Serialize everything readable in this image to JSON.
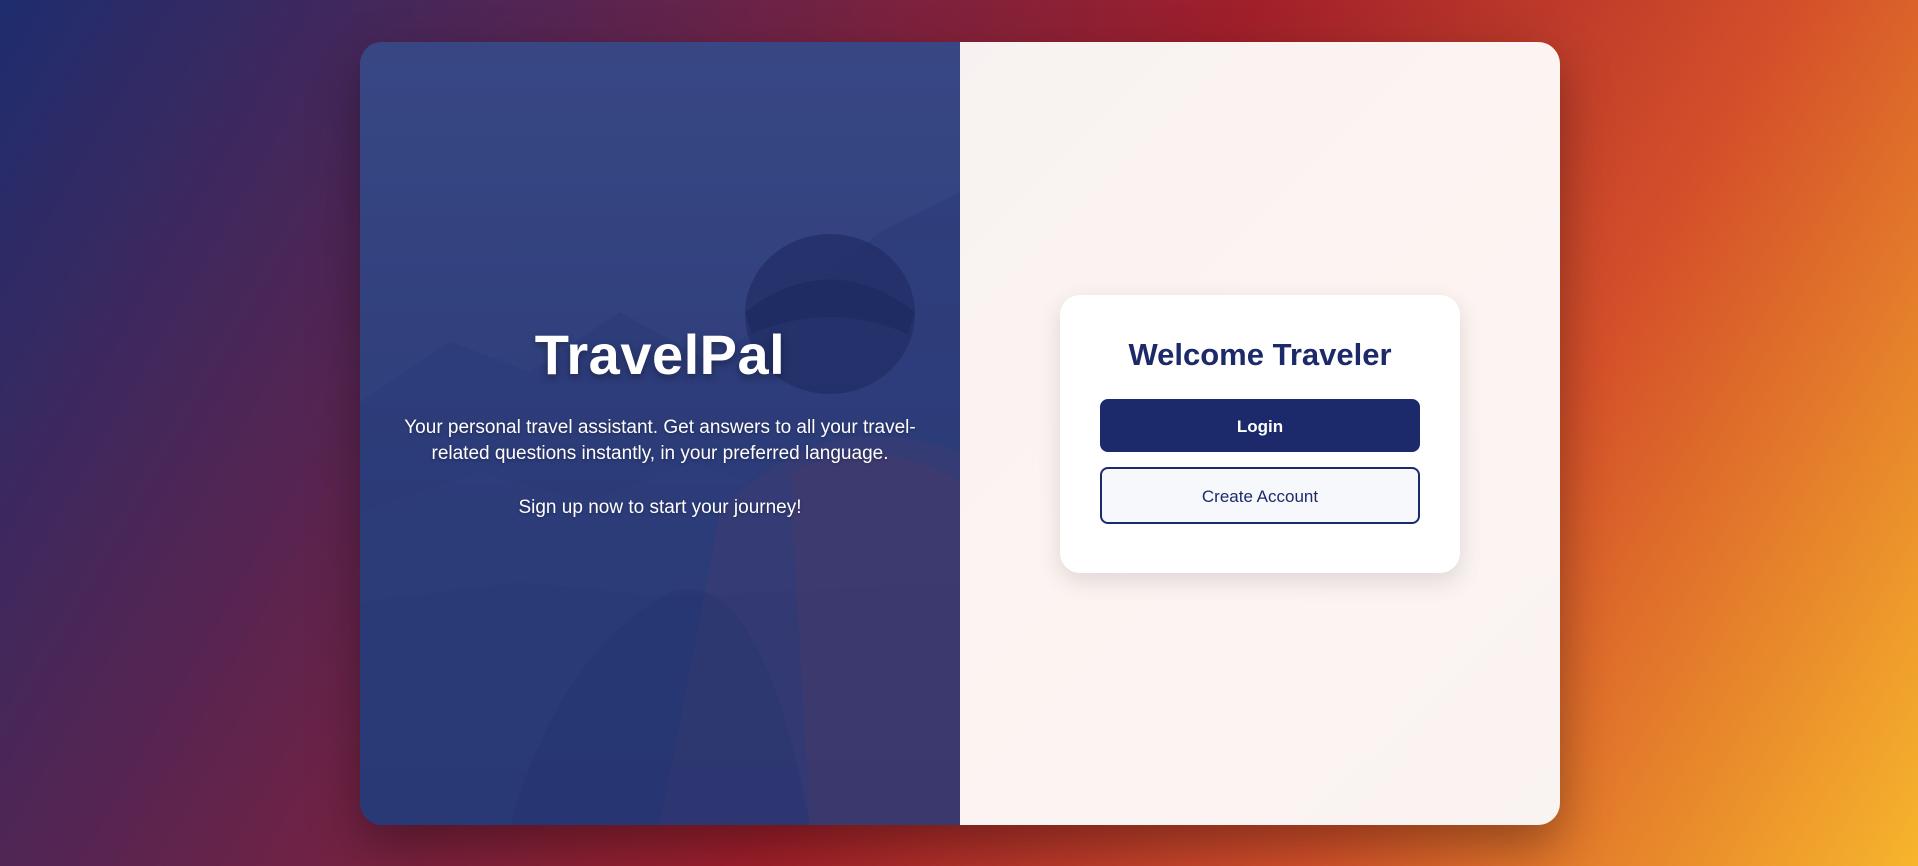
{
  "brand": {
    "title": "TravelPal",
    "description": "Your personal travel assistant. Get answers to all your travel-related questions instantly, in your preferred language.",
    "cta": "Sign up now to start your journey!"
  },
  "auth": {
    "title": "Welcome Traveler",
    "login_label": "Login",
    "create_account_label": "Create Account"
  },
  "colors": {
    "primary": "#1c2a6b",
    "text_light": "#ffffff"
  }
}
